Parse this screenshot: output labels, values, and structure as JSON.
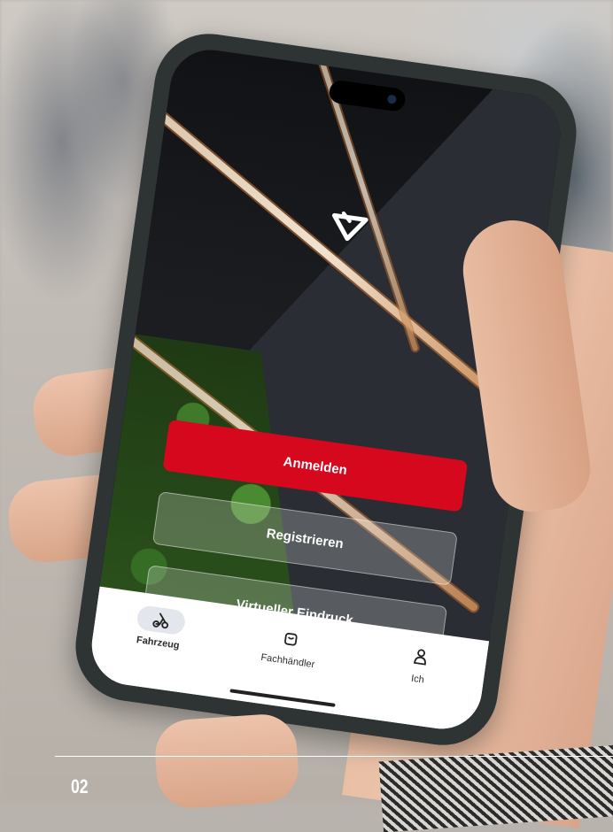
{
  "app": {
    "buttons": {
      "login": "Anmelden",
      "register": "Registrieren",
      "virtual": "Virtueller Eindruck"
    },
    "tabs": [
      {
        "label": "Fahrzeug",
        "icon": "scooter-icon",
        "active": true
      },
      {
        "label": "Fachhändler",
        "icon": "shopping-bag-icon",
        "active": false
      },
      {
        "label": "Ich",
        "icon": "person-icon",
        "active": false
      }
    ],
    "colors": {
      "primary": "#d5081e",
      "tabbar": "#ffffff"
    }
  },
  "page": {
    "number": "02"
  }
}
